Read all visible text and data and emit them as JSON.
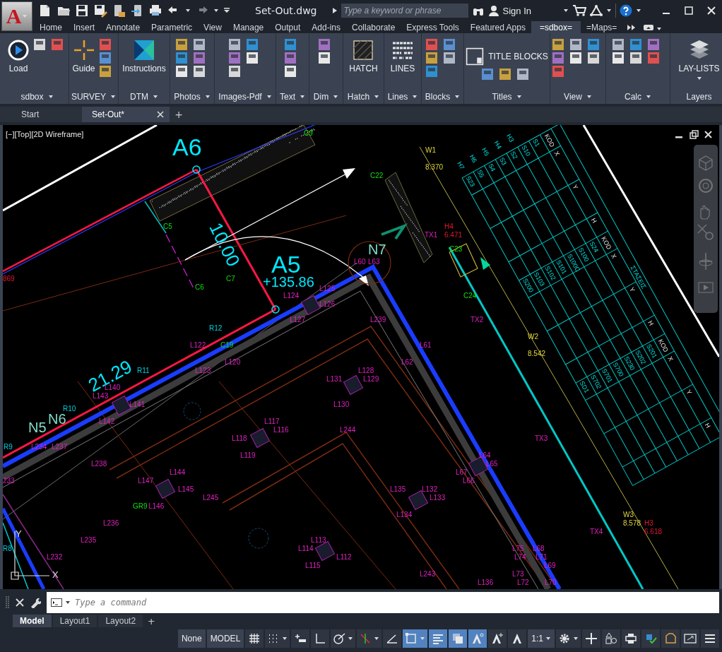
{
  "app_button": {
    "letter": "A"
  },
  "document_title": "Set-Out.dwg",
  "search": {
    "placeholder": "Type a keyword or phrase"
  },
  "sign_in": "Sign In",
  "ribbon_tabs": [
    {
      "label": "Home",
      "selected": false
    },
    {
      "label": "Insert",
      "selected": false
    },
    {
      "label": "Annotate",
      "selected": false
    },
    {
      "label": "Parametric",
      "selected": false
    },
    {
      "label": "View",
      "selected": false
    },
    {
      "label": "Manage",
      "selected": false
    },
    {
      "label": "Output",
      "selected": false
    },
    {
      "label": "Add-ins",
      "selected": false
    },
    {
      "label": "Collaborate",
      "selected": false
    },
    {
      "label": "Express Tools",
      "selected": false
    },
    {
      "label": "Featured Apps",
      "selected": false
    },
    {
      "label": "=sdbox=",
      "selected": true
    },
    {
      "label": "=Maps=",
      "selected": false
    }
  ],
  "ribbon_panels": [
    {
      "title": "sdbox",
      "menu": true,
      "tools": [
        {
          "label": "Load",
          "kind": "play"
        }
      ]
    },
    {
      "title": "SURVEY",
      "menu": true,
      "tools": [
        {
          "label": "Guide",
          "kind": "crosshair"
        }
      ]
    },
    {
      "title": "DTM",
      "menu": true,
      "tools": [
        {
          "label": "Instructions",
          "kind": "gallery"
        }
      ]
    },
    {
      "title": "Photos",
      "menu": true
    },
    {
      "title": "Images-Pdf",
      "menu": true
    },
    {
      "title": "Text",
      "menu": true
    },
    {
      "title": "Dim",
      "menu": true
    },
    {
      "title": "Hatch",
      "menu": true,
      "tools": [
        {
          "label": "HATCH",
          "kind": "hatch"
        }
      ]
    },
    {
      "title": "Lines",
      "menu": true,
      "tools": [
        {
          "label": "LINES",
          "kind": "lines"
        }
      ]
    },
    {
      "title": "Blocks",
      "menu": true
    },
    {
      "title": "Titles",
      "menu": true,
      "tools": [
        {
          "label": "TITLE BLOCKS",
          "kind": "title-block"
        }
      ]
    },
    {
      "title": "View",
      "menu": true
    },
    {
      "title": "Calc",
      "menu": true
    },
    {
      "title": "Layers",
      "menu": false,
      "tools": [
        {
          "label": "LAY-LISTS",
          "kind": "layers"
        }
      ]
    }
  ],
  "doc_tabs": [
    {
      "label": "Start",
      "selected": false,
      "closable": false
    },
    {
      "label": "Set-Out*",
      "selected": true,
      "closable": true
    }
  ],
  "new_tab": "+",
  "viewport_label": "[−][Top][2D Wireframe]",
  "ucs": {
    "x": "X",
    "y": "Y"
  },
  "drawing_labels": [
    {
      "text": "C9",
      "kind": "station"
    },
    {
      "text": "A6",
      "kind": "title"
    },
    {
      "text": "W1",
      "kind": "level"
    },
    {
      "text": "8.370",
      "kind": "level"
    },
    {
      "text": "C22",
      "kind": "station"
    },
    {
      "text": "C5",
      "kind": "station"
    },
    {
      "text": "10.00",
      "kind": "dimension"
    },
    {
      "text": "H4",
      "kind": "height"
    },
    {
      "text": "TX1",
      "kind": "node"
    },
    {
      "text": "6.471",
      "kind": "height"
    },
    {
      "text": "N7",
      "kind": "edge"
    },
    {
      "text": "C23",
      "kind": "station"
    },
    {
      "text": "A5",
      "kind": "title"
    },
    {
      "text": "L60",
      "kind": "node"
    },
    {
      "text": "L63",
      "kind": "node"
    },
    {
      "text": "869",
      "kind": "height"
    },
    {
      "text": "C7",
      "kind": "station"
    },
    {
      "text": "C6",
      "kind": "station"
    },
    {
      "text": "+135.86",
      "kind": "subtitle"
    },
    {
      "text": "L125",
      "kind": "node"
    },
    {
      "text": "L124",
      "kind": "node"
    },
    {
      "text": "C24",
      "kind": "station"
    },
    {
      "text": "L126",
      "kind": "node"
    },
    {
      "text": "L127",
      "kind": "node"
    },
    {
      "text": "L239",
      "kind": "node"
    },
    {
      "text": "TX2",
      "kind": "node"
    },
    {
      "text": "R12",
      "kind": "ref"
    },
    {
      "text": "W2",
      "kind": "level"
    },
    {
      "text": "L122",
      "kind": "node"
    },
    {
      "text": "C19",
      "kind": "station"
    },
    {
      "text": "L61",
      "kind": "node"
    },
    {
      "text": "8.542",
      "kind": "level"
    },
    {
      "text": "21.29",
      "kind": "dimension"
    },
    {
      "text": "L120",
      "kind": "node"
    },
    {
      "text": "L62",
      "kind": "node"
    },
    {
      "text": "R11",
      "kind": "ref"
    },
    {
      "text": "L123",
      "kind": "node"
    },
    {
      "text": "L128",
      "kind": "node"
    },
    {
      "text": "L131",
      "kind": "node"
    },
    {
      "text": "L129",
      "kind": "node"
    },
    {
      "text": "L140",
      "kind": "node"
    },
    {
      "text": "L143",
      "kind": "node"
    },
    {
      "text": "L141",
      "kind": "node"
    },
    {
      "text": "L130",
      "kind": "node"
    },
    {
      "text": "R10",
      "kind": "ref"
    },
    {
      "text": "N5",
      "kind": "edge"
    },
    {
      "text": "N6",
      "kind": "edge"
    },
    {
      "text": "L142",
      "kind": "node"
    },
    {
      "text": "L117",
      "kind": "node"
    },
    {
      "text": "L116",
      "kind": "node"
    },
    {
      "text": "L244",
      "kind": "node"
    },
    {
      "text": "L118",
      "kind": "node"
    },
    {
      "text": "TX3",
      "kind": "node"
    },
    {
      "text": "R9",
      "kind": "ref"
    },
    {
      "text": "L234",
      "kind": "node"
    },
    {
      "text": "L237",
      "kind": "node"
    },
    {
      "text": "L119",
      "kind": "node"
    },
    {
      "text": "L64",
      "kind": "node"
    },
    {
      "text": "L238",
      "kind": "node"
    },
    {
      "text": "L65",
      "kind": "node"
    },
    {
      "text": "L144",
      "kind": "node"
    },
    {
      "text": "L67",
      "kind": "node"
    },
    {
      "text": "233",
      "kind": "node"
    },
    {
      "text": "L147",
      "kind": "node"
    },
    {
      "text": "L66",
      "kind": "node"
    },
    {
      "text": "L145",
      "kind": "node"
    },
    {
      "text": "L135",
      "kind": "node"
    },
    {
      "text": "L132",
      "kind": "node"
    },
    {
      "text": "L245",
      "kind": "node"
    },
    {
      "text": "L133",
      "kind": "node"
    },
    {
      "text": "GR9",
      "kind": "station"
    },
    {
      "text": "L146",
      "kind": "node"
    },
    {
      "text": "L134",
      "kind": "node"
    },
    {
      "text": "W3",
      "kind": "level"
    },
    {
      "text": "L236",
      "kind": "node"
    },
    {
      "text": "8.578",
      "kind": "level"
    },
    {
      "text": "H3",
      "kind": "height"
    },
    {
      "text": "TX4",
      "kind": "node"
    },
    {
      "text": "6.618",
      "kind": "height"
    },
    {
      "text": "L235",
      "kind": "node"
    },
    {
      "text": "L113",
      "kind": "node"
    },
    {
      "text": "R8",
      "kind": "ref"
    },
    {
      "text": "L114",
      "kind": "node"
    },
    {
      "text": "L75",
      "kind": "node"
    },
    {
      "text": "L68",
      "kind": "node"
    },
    {
      "text": "L232",
      "kind": "node"
    },
    {
      "text": "L112",
      "kind": "node"
    },
    {
      "text": "L74",
      "kind": "node"
    },
    {
      "text": "L71",
      "kind": "node"
    },
    {
      "text": "L115",
      "kind": "node"
    },
    {
      "text": "L69",
      "kind": "node"
    },
    {
      "text": "L243",
      "kind": "node"
    },
    {
      "text": "L73",
      "kind": "node"
    },
    {
      "text": "L136",
      "kind": "node"
    },
    {
      "text": "L72",
      "kind": "node"
    },
    {
      "text": "L70",
      "kind": "node"
    }
  ],
  "stations_table": {
    "title": "ΣΤΑΣΕΙΣ",
    "side_headers": [
      "H7",
      "H6",
      "H5",
      "H4",
      "H3"
    ],
    "groups": [
      {
        "headers": [
          "KOD",
          "X",
          "Y",
          "H"
        ],
        "codes": [
          "S1",
          "S10",
          "S2",
          "S3",
          "S4",
          "S5",
          "S23"
        ]
      },
      {
        "headers": [
          "KOD",
          "X",
          "Y",
          "H"
        ],
        "codes": [
          "S24",
          "S100",
          "S100C",
          "S101",
          "S102",
          "S103",
          "S200"
        ]
      },
      {
        "headers": [
          "KOD",
          "X",
          "Y",
          "H"
        ],
        "codes": [
          "S201",
          "S202",
          "S230",
          "S700",
          "S701",
          "S702",
          "SD1"
        ]
      }
    ]
  },
  "command_line": {
    "placeholder": "Type a command"
  },
  "layout_tabs": [
    {
      "label": "Model",
      "selected": true
    },
    {
      "label": "Layout1",
      "selected": false
    },
    {
      "label": "Layout2",
      "selected": false
    }
  ],
  "new_layout": "+",
  "status_items": [
    {
      "kind": "text",
      "label": "None",
      "on": false,
      "menu": false
    },
    {
      "kind": "text",
      "label": "MODEL",
      "on": false,
      "menu": false
    },
    {
      "kind": "grid",
      "on": false,
      "menu": false
    },
    {
      "kind": "snap",
      "on": false,
      "menu": true
    },
    {
      "kind": "infer",
      "on": false,
      "menu": false
    },
    {
      "kind": "ortho",
      "on": false,
      "menu": false
    },
    {
      "kind": "polar",
      "on": false,
      "menu": true
    },
    {
      "kind": "isodraft",
      "on": false,
      "menu": true
    },
    {
      "kind": "angle",
      "on": false,
      "menu": false
    },
    {
      "kind": "selection",
      "on": true,
      "menu": true
    },
    {
      "kind": "lineweight",
      "on": true,
      "menu": false
    },
    {
      "kind": "transparency",
      "on": true,
      "menu": false
    },
    {
      "kind": "annotation",
      "on": true,
      "menu": false
    },
    {
      "kind": "autoscale",
      "on": false,
      "menu": false
    },
    {
      "kind": "annoscale",
      "on": false,
      "menu": false
    },
    {
      "kind": "text",
      "label": "1:1",
      "on": false,
      "menu": true
    },
    {
      "kind": "settings",
      "on": false,
      "menu": true
    },
    {
      "kind": "plus",
      "on": false,
      "menu": false
    },
    {
      "kind": "shapes",
      "on": false,
      "menu": false
    },
    {
      "kind": "print",
      "on": false,
      "menu": false
    },
    {
      "kind": "check",
      "on": false,
      "menu": false
    },
    {
      "kind": "units",
      "on": false,
      "menu": false
    },
    {
      "kind": "fullscreen",
      "on": false,
      "menu": false
    },
    {
      "kind": "menu",
      "on": false,
      "menu": false
    }
  ]
}
